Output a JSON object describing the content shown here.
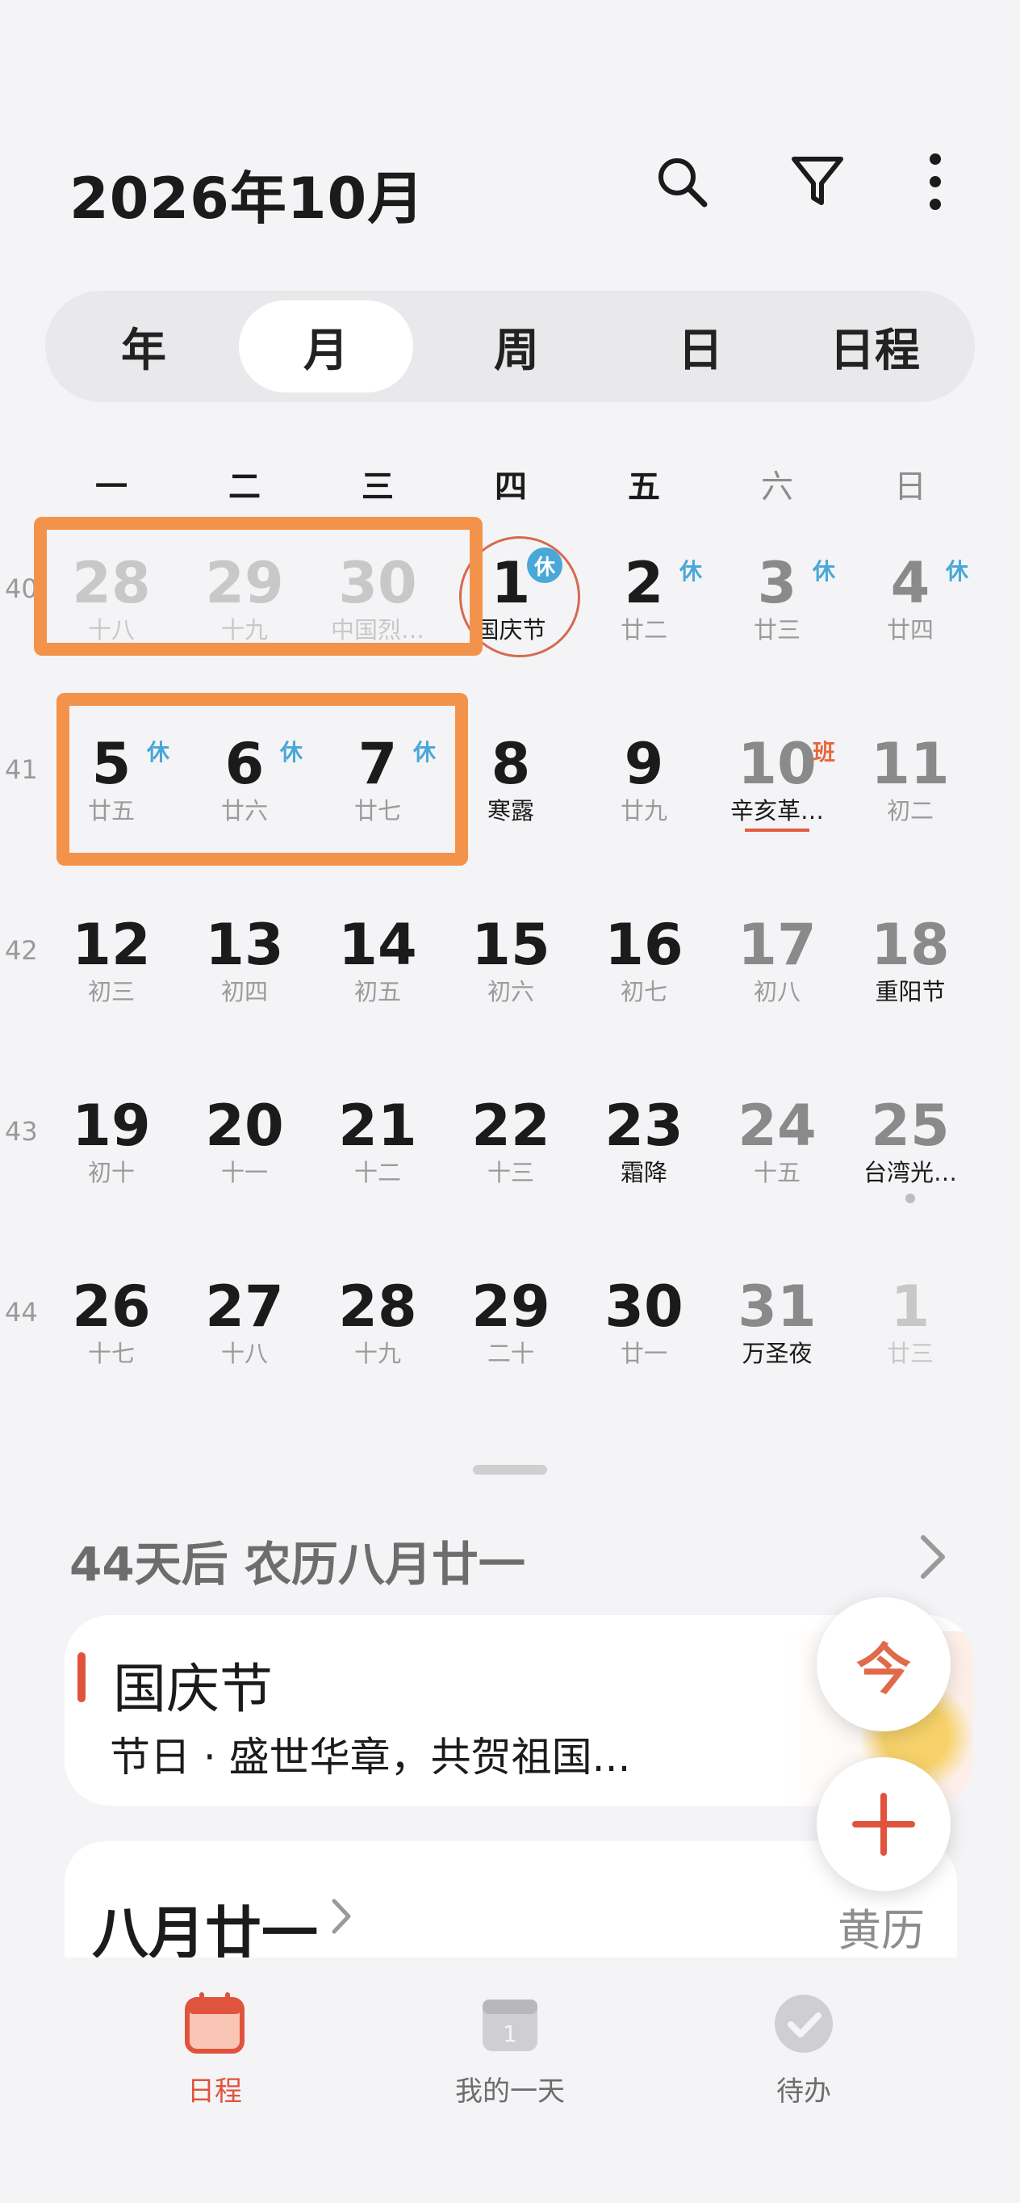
{
  "header": {
    "title": "2026年10月",
    "icons": [
      "search-icon",
      "filter-icon",
      "more-icon"
    ]
  },
  "view_tabs": [
    {
      "label": "年",
      "active": false
    },
    {
      "label": "月",
      "active": true
    },
    {
      "label": "周",
      "active": false
    },
    {
      "label": "日",
      "active": false
    },
    {
      "label": "日程",
      "active": false
    }
  ],
  "weekdays": [
    "一",
    "二",
    "三",
    "四",
    "五",
    "六",
    "日"
  ],
  "weeks": [
    {
      "number": "40",
      "days": [
        {
          "day": "28",
          "lunar": "十八",
          "muted": true
        },
        {
          "day": "29",
          "lunar": "十九",
          "muted": true
        },
        {
          "day": "30",
          "lunar": "中国烈…",
          "muted": true
        },
        {
          "day": "1",
          "lunar": "国庆节",
          "badge": "休",
          "today": true,
          "festival": true
        },
        {
          "day": "2",
          "lunar": "廿二",
          "badge": "休"
        },
        {
          "day": "3",
          "lunar": "廿三",
          "badge": "休"
        },
        {
          "day": "4",
          "lunar": "廿四",
          "badge": "休"
        }
      ]
    },
    {
      "number": "41",
      "days": [
        {
          "day": "5",
          "lunar": "廿五",
          "badge": "休"
        },
        {
          "day": "6",
          "lunar": "廿六",
          "badge": "休"
        },
        {
          "day": "7",
          "lunar": "廿七",
          "badge": "休"
        },
        {
          "day": "8",
          "lunar": "寒露",
          "festival": true
        },
        {
          "day": "9",
          "lunar": "廿九"
        },
        {
          "day": "10",
          "lunar": "辛亥革…",
          "badge": "班",
          "festival": true,
          "underline": true
        },
        {
          "day": "11",
          "lunar": "初二"
        }
      ]
    },
    {
      "number": "42",
      "days": [
        {
          "day": "12",
          "lunar": "初三"
        },
        {
          "day": "13",
          "lunar": "初四"
        },
        {
          "day": "14",
          "lunar": "初五"
        },
        {
          "day": "15",
          "lunar": "初六"
        },
        {
          "day": "16",
          "lunar": "初七"
        },
        {
          "day": "17",
          "lunar": "初八"
        },
        {
          "day": "18",
          "lunar": "重阳节",
          "festival": true
        }
      ]
    },
    {
      "number": "43",
      "days": [
        {
          "day": "19",
          "lunar": "初十"
        },
        {
          "day": "20",
          "lunar": "十一"
        },
        {
          "day": "21",
          "lunar": "十二"
        },
        {
          "day": "22",
          "lunar": "十三"
        },
        {
          "day": "23",
          "lunar": "霜降",
          "festival": true
        },
        {
          "day": "24",
          "lunar": "十五"
        },
        {
          "day": "25",
          "lunar": "台湾光…",
          "festival": true,
          "dot": true
        }
      ]
    },
    {
      "number": "44",
      "days": [
        {
          "day": "26",
          "lunar": "十七"
        },
        {
          "day": "27",
          "lunar": "十八"
        },
        {
          "day": "28",
          "lunar": "十九"
        },
        {
          "day": "29",
          "lunar": "二十"
        },
        {
          "day": "30",
          "lunar": "廿一"
        },
        {
          "day": "31",
          "lunar": "万圣夜",
          "festival": true
        },
        {
          "day": "1",
          "lunar": "廿三",
          "muted": true
        }
      ]
    }
  ],
  "summary": "44天后 农历八月廿一",
  "event": {
    "title": "国庆节",
    "description": "节日 · 盛世华章，共贺祖国..."
  },
  "lunar_card": {
    "title": "八月廿一",
    "almanac": "黄历"
  },
  "fab": {
    "today_label": "今"
  },
  "bottom_nav": [
    {
      "label": "日程",
      "icon": "calendar-icon",
      "active": true
    },
    {
      "label": "我的一天",
      "icon": "my-day-icon",
      "active": false
    },
    {
      "label": "待办",
      "icon": "todo-check-icon",
      "active": false
    }
  ],
  "colors": {
    "accent": "#e0533c",
    "highlight_box": "#f3934b",
    "holiday_badge": "#4aa8d8",
    "work_badge": "#e8663e"
  }
}
